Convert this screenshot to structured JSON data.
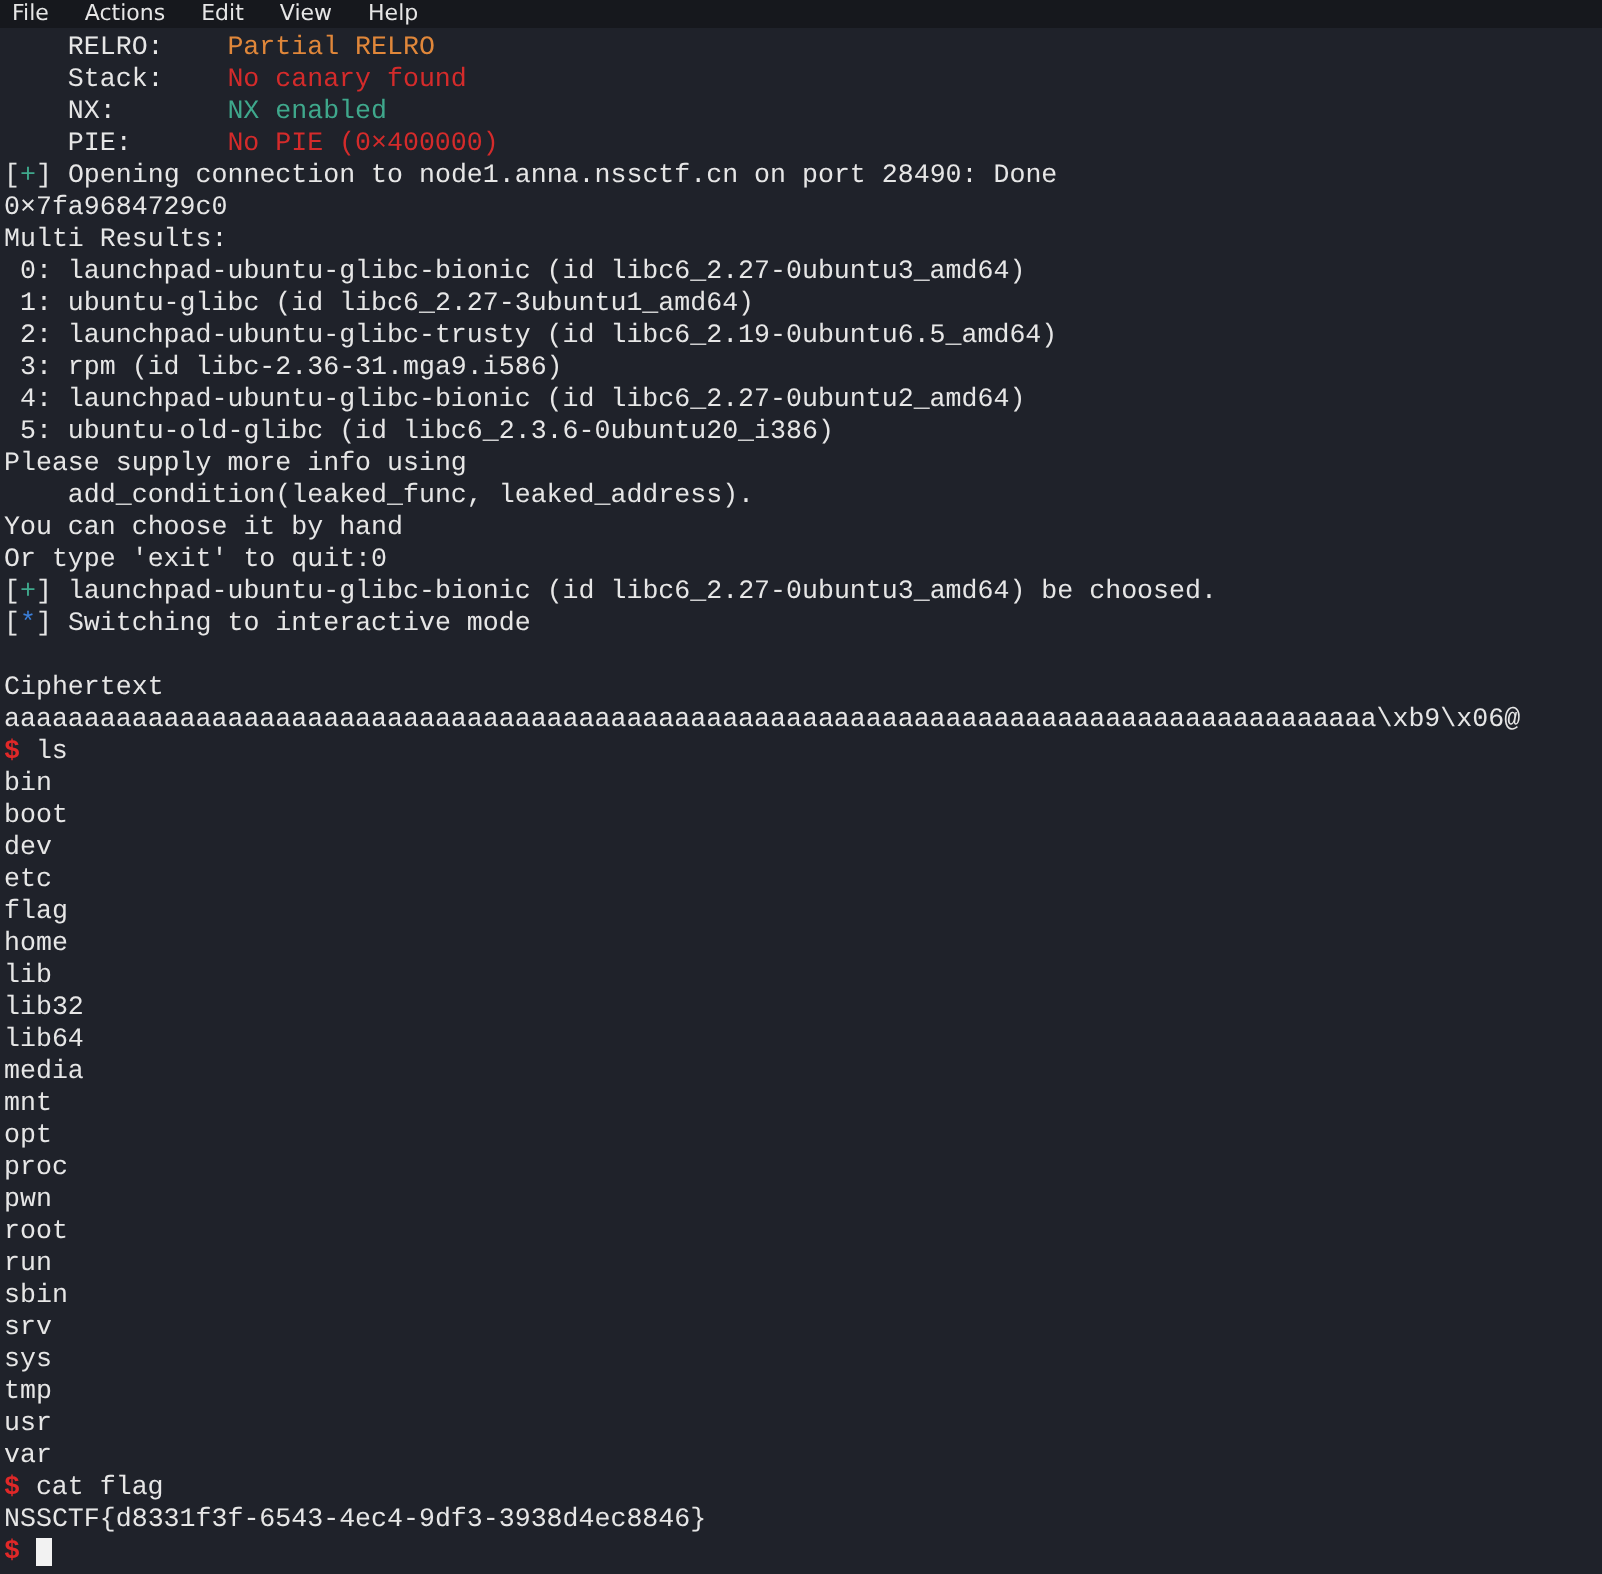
{
  "menu": [
    "File",
    "Actions",
    "Edit",
    "View",
    "Help"
  ],
  "lines": [
    {
      "kind": "field",
      "label": "RELRO:",
      "value": "Partial RELRO",
      "color": "#e0873a"
    },
    {
      "kind": "field",
      "label": "Stack:",
      "value": "No canary found",
      "color": "#d42b2b"
    },
    {
      "kind": "field",
      "label": "NX:",
      "value": "NX enabled",
      "color": "#3fa88c"
    },
    {
      "kind": "field",
      "label": "PIE:",
      "value": "No PIE (0×400000)",
      "color": "#d42b2b"
    },
    {
      "kind": "status",
      "marker": "[+]",
      "color": "#3fa88c",
      "text": "Opening connection to node1.anna.nssctf.cn on port 28490: Done"
    },
    {
      "kind": "plain",
      "text": "0×7fa9684729c0"
    },
    {
      "kind": "plain",
      "text": "Multi Results:"
    },
    {
      "kind": "plain",
      "text": " 0: launchpad-ubuntu-glibc-bionic (id libc6_2.27-0ubuntu3_amd64)"
    },
    {
      "kind": "plain",
      "text": " 1: ubuntu-glibc (id libc6_2.27-3ubuntu1_amd64)"
    },
    {
      "kind": "plain",
      "text": " 2: launchpad-ubuntu-glibc-trusty (id libc6_2.19-0ubuntu6.5_amd64)"
    },
    {
      "kind": "plain",
      "text": " 3: rpm (id libc-2.36-31.mga9.i586)"
    },
    {
      "kind": "plain",
      "text": " 4: launchpad-ubuntu-glibc-bionic (id libc6_2.27-0ubuntu2_amd64)"
    },
    {
      "kind": "plain",
      "text": " 5: ubuntu-old-glibc (id libc6_2.3.6-0ubuntu20_i386)"
    },
    {
      "kind": "plain",
      "text": "Please supply more info using"
    },
    {
      "kind": "plain",
      "text": "    add_condition(leaked_func, leaked_address)."
    },
    {
      "kind": "plain",
      "text": "You can choose it by hand"
    },
    {
      "kind": "plain",
      "text": "Or type 'exit' to quit:0"
    },
    {
      "kind": "status",
      "marker": "[+]",
      "color": "#3fa88c",
      "text": "launchpad-ubuntu-glibc-bionic (id libc6_2.27-0ubuntu3_amd64) be choosed."
    },
    {
      "kind": "status",
      "marker": "[*]",
      "color": "#3b7fd9",
      "text": "Switching to interactive mode"
    },
    {
      "kind": "blank"
    },
    {
      "kind": "plain",
      "text": "Ciphertext"
    },
    {
      "kind": "plain",
      "text": "aaaaaaaaaaaaaaaaaaaaaaaaaaaaaaaaaaaaaaaaaaaaaaaaaaaaaaaaaaaaaaaaaaaaaaaaaaaaaaaaaaaaaa\\xb9\\x06@"
    },
    {
      "kind": "prompt",
      "symbol": "$",
      "command": "ls"
    },
    {
      "kind": "plain",
      "text": "bin"
    },
    {
      "kind": "plain",
      "text": "boot"
    },
    {
      "kind": "plain",
      "text": "dev"
    },
    {
      "kind": "plain",
      "text": "etc"
    },
    {
      "kind": "plain",
      "text": "flag"
    },
    {
      "kind": "plain",
      "text": "home"
    },
    {
      "kind": "plain",
      "text": "lib"
    },
    {
      "kind": "plain",
      "text": "lib32"
    },
    {
      "kind": "plain",
      "text": "lib64"
    },
    {
      "kind": "plain",
      "text": "media"
    },
    {
      "kind": "plain",
      "text": "mnt"
    },
    {
      "kind": "plain",
      "text": "opt"
    },
    {
      "kind": "plain",
      "text": "proc"
    },
    {
      "kind": "plain",
      "text": "pwn"
    },
    {
      "kind": "plain",
      "text": "root"
    },
    {
      "kind": "plain",
      "text": "run"
    },
    {
      "kind": "plain",
      "text": "sbin"
    },
    {
      "kind": "plain",
      "text": "srv"
    },
    {
      "kind": "plain",
      "text": "sys"
    },
    {
      "kind": "plain",
      "text": "tmp"
    },
    {
      "kind": "plain",
      "text": "usr"
    },
    {
      "kind": "plain",
      "text": "var"
    },
    {
      "kind": "prompt",
      "symbol": "$",
      "command": "cat flag"
    },
    {
      "kind": "plain",
      "text": "NSSCTF{d8331f3f-6543-4ec4-9df3-3938d4ec8846}"
    },
    {
      "kind": "cursor",
      "symbol": "$"
    }
  ]
}
